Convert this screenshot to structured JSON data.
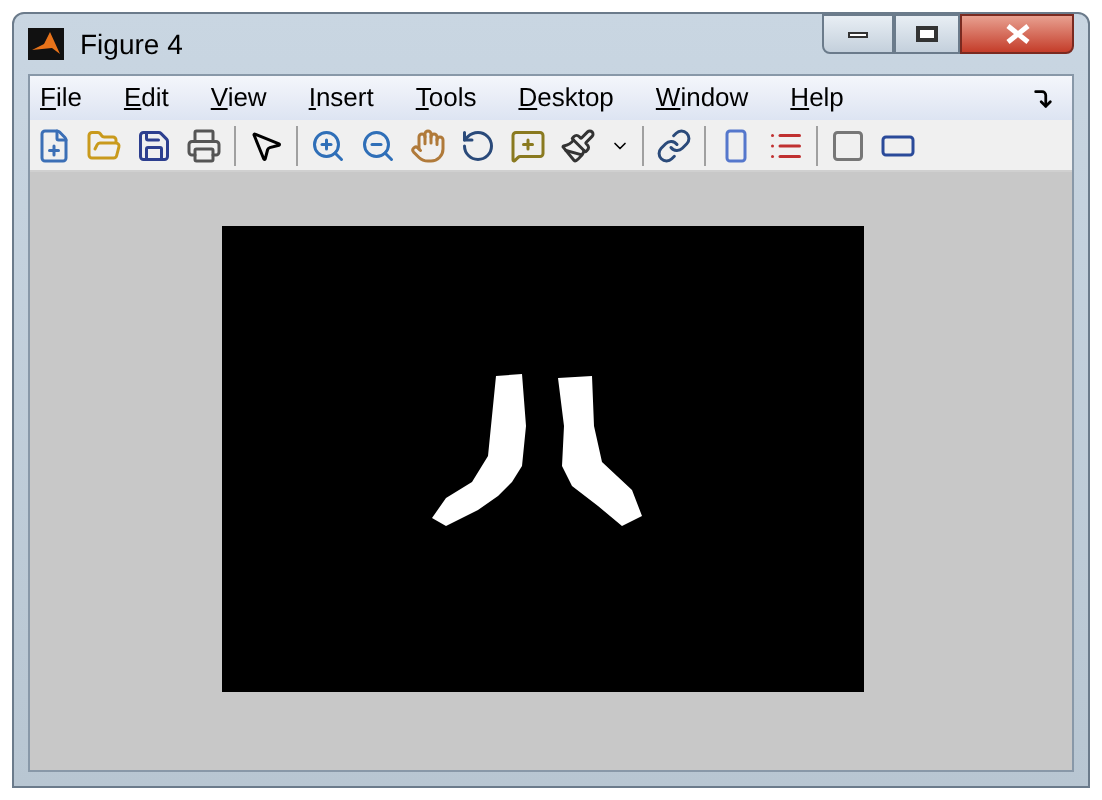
{
  "window": {
    "title": "Figure 4"
  },
  "menu": [
    "File",
    "Edit",
    "View",
    "Insert",
    "Tools",
    "Desktop",
    "Window",
    "Help"
  ]
}
